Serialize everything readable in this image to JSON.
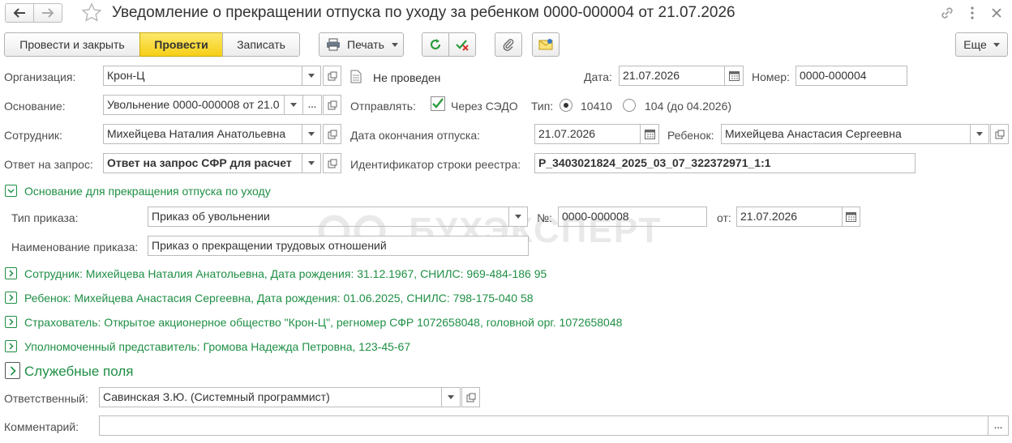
{
  "header": {
    "title": "Уведомление о прекращении отпуска по уходу за ребенком 0000-000004 от 21.07.2026"
  },
  "toolbar": {
    "post_close": "Провести и закрыть",
    "post": "Провести",
    "save": "Записать",
    "print": "Печать",
    "more": "Еще"
  },
  "form": {
    "org_label": "Организация:",
    "org_value": "Крон-Ц",
    "status": "Не проведен",
    "date_label": "Дата:",
    "date_value": "21.07.2026",
    "number_label": "Номер:",
    "number_value": "0000-000004",
    "basis_label": "Основание:",
    "basis_value": "Увольнение 0000-000008 от 21.0",
    "send_label": "Отправлять:",
    "sedo_label": "Через СЭДО",
    "type_label": "Тип:",
    "type_opt1": "10410",
    "type_opt2": "104 (до 04.2026)",
    "employee_label": "Сотрудник:",
    "employee_value": "Михейцева Наталия Анатольевна",
    "leave_end_label": "Дата окончания отпуска:",
    "leave_end_value": "21.07.2026",
    "child_label": "Ребенок:",
    "child_value": "Михейцева Анастасия Сергеевна",
    "reply_label": "Ответ на запрос:",
    "reply_value": "Ответ на запрос СФР для расчет",
    "registry_label": "Идентификатор строки реестра:",
    "registry_value": "P_3403021824_2025_03_07_322372971_1:1"
  },
  "basis_section": {
    "title": "Основание для прекращения отпуска по уходу",
    "order_type_label": "Тип приказа:",
    "order_type_value": "Приказ об увольнении",
    "num_label": "№:",
    "num_value": "0000-000008",
    "from_label": "от:",
    "from_value": "21.07.2026",
    "order_name_label": "Наименование приказа:",
    "order_name_value": "Приказ о прекращении трудовых отношений"
  },
  "collapsed": {
    "employee": "Сотрудник: Михейцева Наталия Анатольевна, Дата рождения: 31.12.1967, СНИЛС: 969-484-186 95",
    "child": "Ребенок: Михейцева Анастасия Сергеевна, Дата рождения: 01.06.2025, СНИЛС: 798-175-040 58",
    "insurer": "Страхователь: Открытое акционерное общество \"Крон-Ц\", регномер СФР 1072658048, головной орг. 1072658048",
    "representative": "Уполномоченный представитель: Громова Надежда Петровна, 123-45-67"
  },
  "service": {
    "title": "Служебные поля",
    "responsible_label": "Ответственный:",
    "responsible_value": "Савинская З.Ю. (Системный программист)",
    "comment_label": "Комментарий:",
    "comment_value": ""
  },
  "watermark": "БУХЭКСПЕРТ",
  "colors": {
    "accent_green": "#1f8f45",
    "primary_button": "#f5cf17"
  }
}
